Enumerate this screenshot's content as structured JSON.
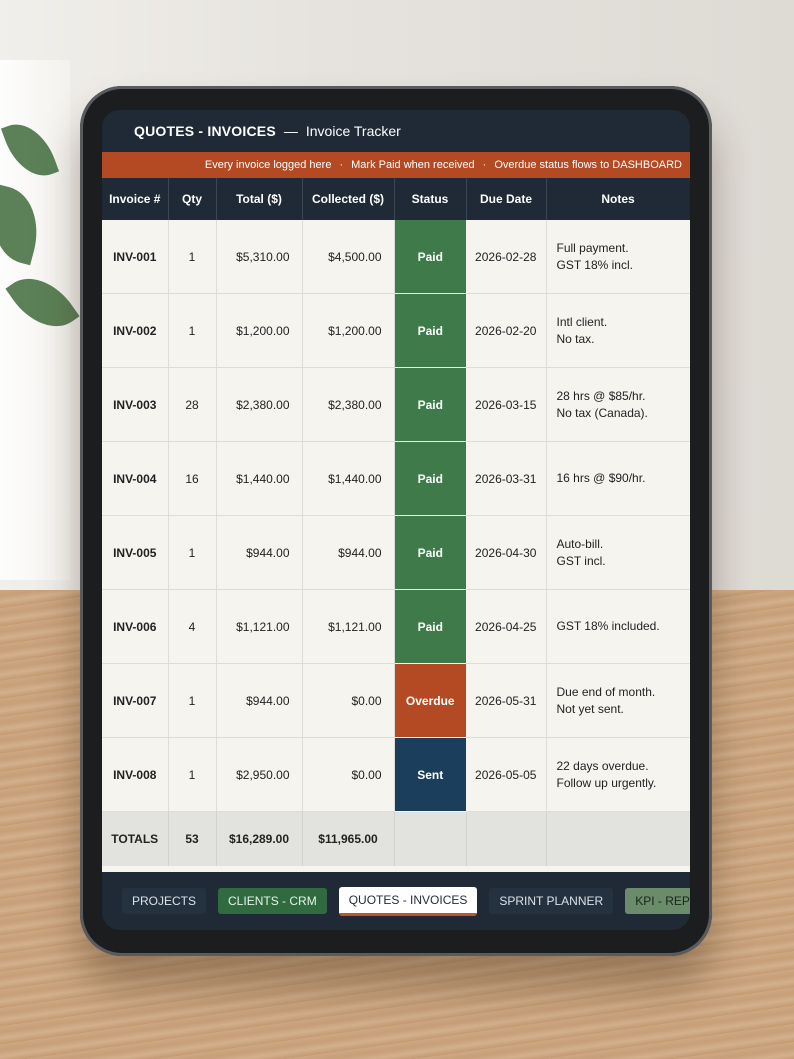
{
  "app": {
    "name": "QUOTES - INVOICES",
    "separator": "—",
    "subtitle": "Invoice Tracker"
  },
  "banner": {
    "items": [
      "Every invoice logged here",
      "Mark Paid when received",
      "Overdue status flows to DASHBOARD"
    ],
    "dot": "·"
  },
  "table": {
    "columns": [
      "Invoice #",
      "Qty",
      "Total ($)",
      "Collected ($)",
      "Status",
      "Due Date",
      "Notes"
    ],
    "rows": [
      {
        "invoice": "INV-001",
        "qty": "1",
        "total": "$5,310.00",
        "collected": "$4,500.00",
        "status": "Paid",
        "due": "2026-02-28",
        "note1": "Full payment.",
        "note2": "GST 18% incl."
      },
      {
        "invoice": "INV-002",
        "qty": "1",
        "total": "$1,200.00",
        "collected": "$1,200.00",
        "status": "Paid",
        "due": "2026-02-20",
        "note1": "Intl client.",
        "note2": "No tax."
      },
      {
        "invoice": "INV-003",
        "qty": "28",
        "total": "$2,380.00",
        "collected": "$2,380.00",
        "status": "Paid",
        "due": "2026-03-15",
        "note1": "28 hrs @ $85/hr.",
        "note2": "No tax (Canada)."
      },
      {
        "invoice": "INV-004",
        "qty": "16",
        "total": "$1,440.00",
        "collected": "$1,440.00",
        "status": "Paid",
        "due": "2026-03-31",
        "note1": "16 hrs @ $90/hr.",
        "note2": ""
      },
      {
        "invoice": "INV-005",
        "qty": "1",
        "total": "$944.00",
        "collected": "$944.00",
        "status": "Paid",
        "due": "2026-04-30",
        "note1": "Auto-bill.",
        "note2": "GST incl."
      },
      {
        "invoice": "INV-006",
        "qty": "4",
        "total": "$1,121.00",
        "collected": "$1,121.00",
        "status": "Paid",
        "due": "2026-04-25",
        "note1": "GST 18% included.",
        "note2": ""
      },
      {
        "invoice": "INV-007",
        "qty": "1",
        "total": "$944.00",
        "collected": "$0.00",
        "status": "Overdue",
        "due": "2026-05-31",
        "note1": "Due end of month.",
        "note2": "Not yet sent."
      },
      {
        "invoice": "INV-008",
        "qty": "1",
        "total": "$2,950.00",
        "collected": "$0.00",
        "status": "Sent",
        "due": "2026-05-05",
        "note1": "22 days overdue.",
        "note2": "Follow up urgently."
      }
    ],
    "totals": {
      "label": "TOTALS",
      "qty": "53",
      "total": "$16,289.00",
      "collected": "$11,965.00"
    }
  },
  "tabs": [
    {
      "label": "PROJECTS",
      "style": "dark"
    },
    {
      "label": "CLIENTS - CRM",
      "style": "green"
    },
    {
      "label": "QUOTES - INVOICES",
      "style": "active"
    },
    {
      "label": "SPRINT PLANNER",
      "style": "dark"
    },
    {
      "label": "KPI - REPORT",
      "style": "lightgreen"
    }
  ],
  "more_label": "•••",
  "colors": {
    "paid": "#3f7a4a",
    "overdue": "#b34a24",
    "sent": "#1b3e5c",
    "header": "#1f2a36",
    "accent": "#b34a24"
  }
}
